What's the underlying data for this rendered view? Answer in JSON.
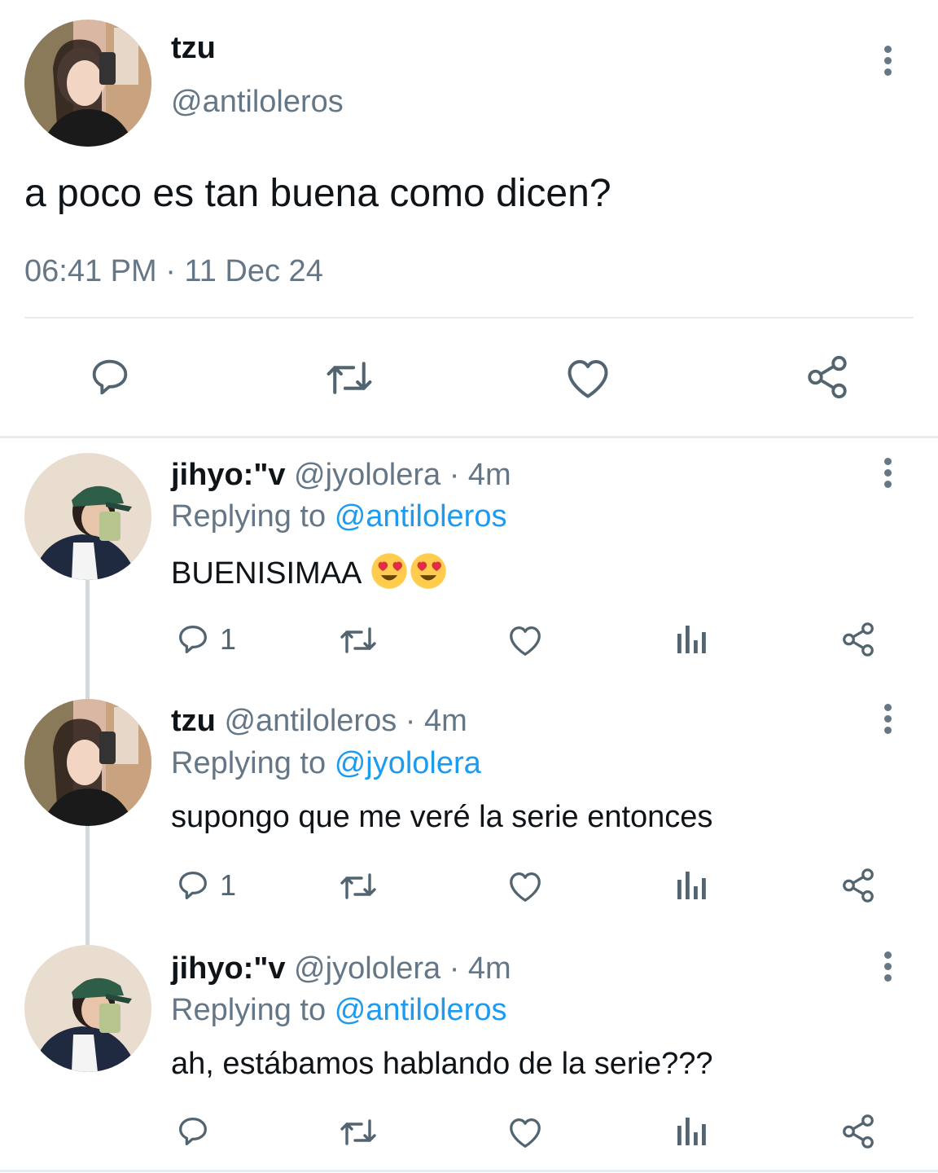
{
  "main_tweet": {
    "display_name": "tzu",
    "handle": "@antiloleros",
    "text": "a poco es tan buena como dicen?",
    "timestamp": "06:41 PM · 11 Dec 24",
    "actions": [
      "reply-icon",
      "retweet-icon",
      "like-icon",
      "share-icon"
    ]
  },
  "replies": [
    {
      "display_name": "jihyo:\"v",
      "handle": "@jyololera",
      "age": "· 4m",
      "replying_label": "Replying to",
      "replying_to": "@antiloleros",
      "text": "BUENISIMAA",
      "emoji": [
        "heart-eyes-emoji",
        "heart-eyes-emoji"
      ],
      "reply_count": "1"
    },
    {
      "display_name": "tzu",
      "handle": "@antiloleros",
      "age": "· 4m",
      "replying_label": "Replying to",
      "replying_to": "@jyololera",
      "text": "supongo que me veré la serie entonces",
      "reply_count": "1"
    },
    {
      "display_name": "jihyo:\"v",
      "handle": "@jyololera",
      "age": "· 4m",
      "replying_label": "Replying to",
      "replying_to": "@antiloleros",
      "text": "ah, estábamos hablando de la serie???",
      "reply_count": ""
    }
  ],
  "colors": {
    "text": "#0f1419",
    "muted": "#657786",
    "link": "#1d9bf0",
    "divider": "#e6ecf0"
  }
}
